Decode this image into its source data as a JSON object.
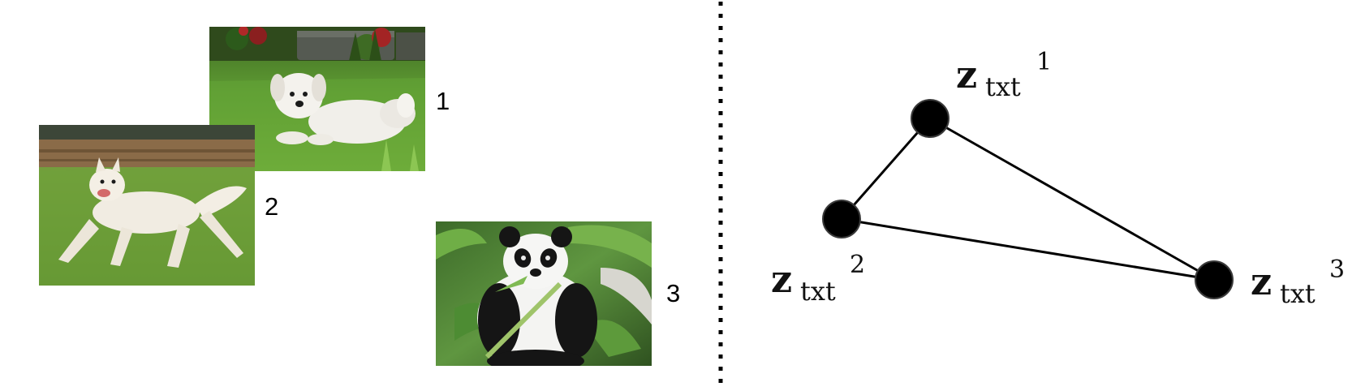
{
  "left_panel": {
    "images": [
      {
        "number": "1",
        "subject": "small white fluffy dog lying on grass"
      },
      {
        "number": "2",
        "subject": "white dog running on grass"
      },
      {
        "number": "3",
        "subject": "giant panda eating bamboo"
      }
    ]
  },
  "right_panel": {
    "nodes": [
      {
        "symbol": "z",
        "subscript": "txt",
        "superscript": "1"
      },
      {
        "symbol": "z",
        "subscript": "txt",
        "superscript": "2"
      },
      {
        "symbol": "z",
        "subscript": "txt",
        "superscript": "3"
      }
    ],
    "edges": [
      [
        "1",
        "2"
      ],
      [
        "2",
        "3"
      ],
      [
        "1",
        "3"
      ]
    ]
  },
  "colors": {
    "line": "#000000",
    "node": "#000000",
    "node_outline": "#3a3a3a",
    "grass": "#4f8f2c",
    "panda_black": "#151515",
    "panda_white": "#f4f4f2"
  }
}
